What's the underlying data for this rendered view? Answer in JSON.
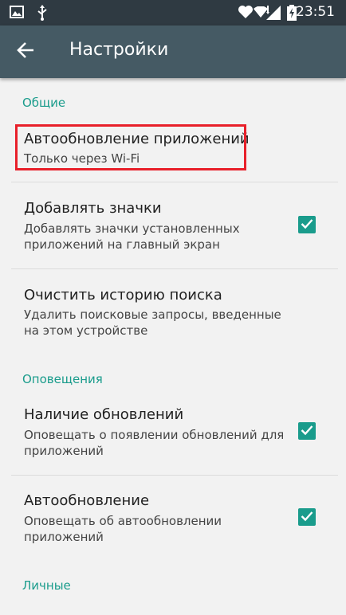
{
  "status_bar": {
    "time": "23:51",
    "icons": [
      "image-icon",
      "usb-icon",
      "heart-icon",
      "wifi-icon",
      "signal-icon",
      "battery-charging-icon"
    ]
  },
  "app_bar": {
    "title": "Настройки",
    "back_icon": "arrow-left-icon"
  },
  "sections": {
    "general": {
      "header": "Общие",
      "auto_update_apps": {
        "title": "Автообновление приложений",
        "summary": "Только через Wi-Fi"
      },
      "add_icons": {
        "title": "Добавлять значки",
        "summary": "Добавлять значки установленных приложений на главный экран",
        "checked": true
      },
      "clear_history": {
        "title": "Очистить историю поиска",
        "summary": "Удалить поисковые запросы, введенные на этом устройстве"
      }
    },
    "notifications": {
      "header": "Оповещения",
      "updates_available": {
        "title": "Наличие обновлений",
        "summary": "Оповещать о появлении обновлений для приложений",
        "checked": true
      },
      "auto_update": {
        "title": "Автообновление",
        "summary": "Оповещать об автообновлении приложений",
        "checked": true
      }
    },
    "personal": {
      "header": "Личные"
    }
  },
  "colors": {
    "status_bar": "#2f3a42",
    "app_bar": "#455a64",
    "accent": "#1a9c8c",
    "highlight": "#e8202a",
    "background": "#f2f2f2"
  }
}
